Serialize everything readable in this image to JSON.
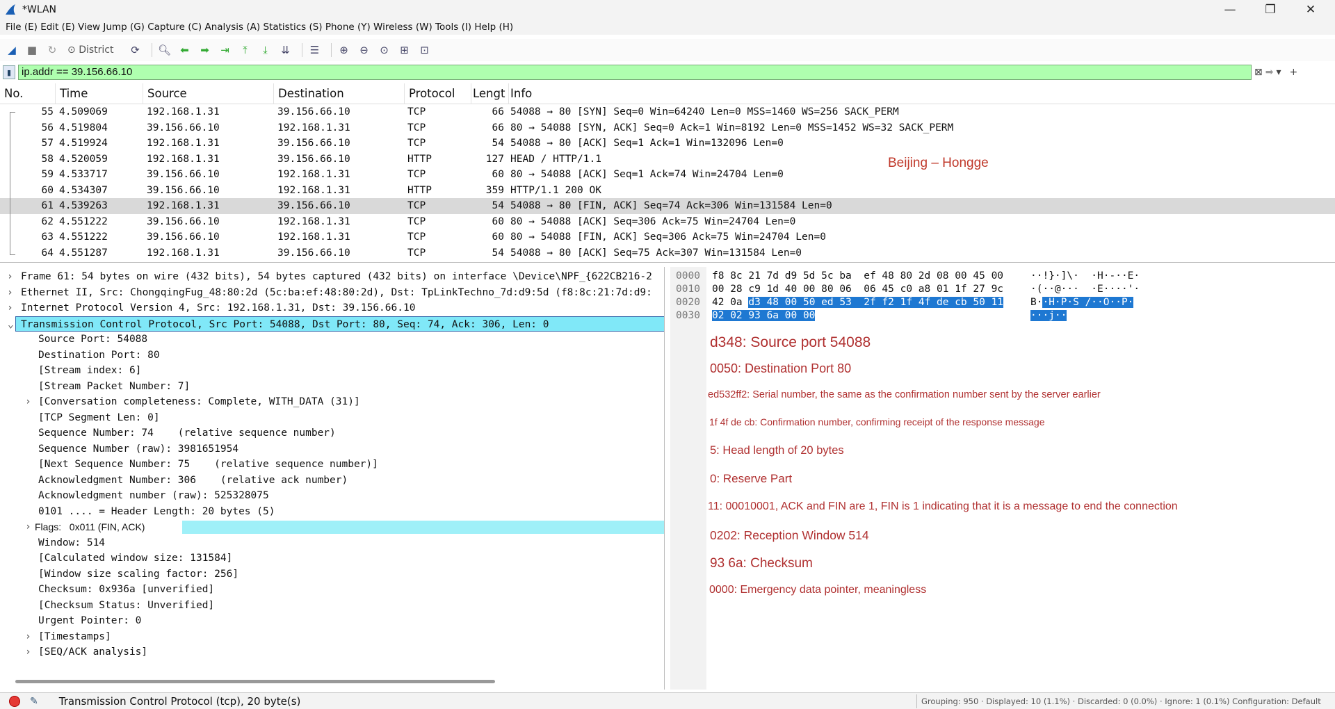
{
  "window": {
    "title": "*WLAN"
  },
  "menu": [
    "File (E)",
    "Edit (E)",
    "View",
    "Jump (G)",
    "Capture (C)",
    "Analysis (A)",
    "Statistics (S)",
    "Phone (Y)",
    "Wireless (W)",
    "Tools (I)",
    "Help (H)"
  ],
  "toolbar": {
    "district_label": "District"
  },
  "filter": {
    "value": "ip.addr == 39.156.66.10"
  },
  "packet_list": {
    "columns": [
      "No.",
      "Time",
      "Source",
      "Destination",
      "Protocol",
      "Lengt",
      "Info"
    ],
    "selected_no": "61",
    "rows": [
      {
        "no": "55",
        "time": "4.509069",
        "src": "192.168.1.31",
        "dst": "39.156.66.10",
        "proto": "TCP",
        "len": "66",
        "info": "54088 → 80 [SYN] Seq=0 Win=64240 Len=0 MSS=1460 WS=256 SACK_PERM"
      },
      {
        "no": "56",
        "time": "4.519804",
        "src": "39.156.66.10",
        "dst": "192.168.1.31",
        "proto": "TCP",
        "len": "66",
        "info": "80 → 54088 [SYN, ACK] Seq=0 Ack=1 Win=8192 Len=0 MSS=1452 WS=32 SACK_PERM"
      },
      {
        "no": "57",
        "time": "4.519924",
        "src": "192.168.1.31",
        "dst": "39.156.66.10",
        "proto": "TCP",
        "len": "54",
        "info": "54088 → 80 [ACK] Seq=1 Ack=1 Win=132096 Len=0"
      },
      {
        "no": "58",
        "time": "4.520059",
        "src": "192.168.1.31",
        "dst": "39.156.66.10",
        "proto": "HTTP",
        "len": "127",
        "info": "HEAD / HTTP/1.1"
      },
      {
        "no": "59",
        "time": "4.533717",
        "src": "39.156.66.10",
        "dst": "192.168.1.31",
        "proto": "TCP",
        "len": "60",
        "info": "80 → 54088 [ACK] Seq=1 Ack=74 Win=24704 Len=0"
      },
      {
        "no": "60",
        "time": "4.534307",
        "src": "39.156.66.10",
        "dst": "192.168.1.31",
        "proto": "HTTP",
        "len": "359",
        "info": "HTTP/1.1 200 OK"
      },
      {
        "no": "61",
        "time": "4.539263",
        "src": "192.168.1.31",
        "dst": "39.156.66.10",
        "proto": "TCP",
        "len": "54",
        "info": "54088 → 80 [FIN, ACK] Seq=74 Ack=306 Win=131584 Len=0"
      },
      {
        "no": "62",
        "time": "4.551222",
        "src": "39.156.66.10",
        "dst": "192.168.1.31",
        "proto": "TCP",
        "len": "60",
        "info": "80 → 54088 [ACK] Seq=306 Ack=75 Win=24704 Len=0"
      },
      {
        "no": "63",
        "time": "4.551222",
        "src": "39.156.66.10",
        "dst": "192.168.1.31",
        "proto": "TCP",
        "len": "60",
        "info": "80 → 54088 [FIN, ACK] Seq=306 Ack=75 Win=24704 Len=0"
      },
      {
        "no": "64",
        "time": "4.551287",
        "src": "192.168.1.31",
        "dst": "39.156.66.10",
        "proto": "TCP",
        "len": "54",
        "info": "54088 → 80 [ACK] Seq=75 Ack=307 Win=131584 Len=0"
      }
    ],
    "annotation": "Beijing – Hongge"
  },
  "details": [
    {
      "arrow": ">",
      "indent": 0,
      "text": "Frame 61: 54 bytes on wire (432 bits), 54 bytes captured (432 bits) on interface \\Device\\NPF_{622CB216-2"
    },
    {
      "arrow": ">",
      "indent": 0,
      "text": "Ethernet II, Src: ChongqingFug_48:80:2d (5c:ba:ef:48:80:2d), Dst: TpLinkTechno_7d:d9:5d (f8:8c:21:7d:d9:"
    },
    {
      "arrow": ">",
      "indent": 0,
      "text": "Internet Protocol Version 4, Src: 192.168.1.31, Dst: 39.156.66.10"
    },
    {
      "arrow": "v",
      "indent": 0,
      "text": "Transmission Control Protocol, Src Port: 54088, Dst Port: 80, Seq: 74, Ack: 306, Len: 0",
      "selected": true
    },
    {
      "arrow": "",
      "indent": 1,
      "text": "Source Port: 54088"
    },
    {
      "arrow": "",
      "indent": 1,
      "text": "Destination Port: 80"
    },
    {
      "arrow": "",
      "indent": 1,
      "text": "[Stream index: 6]"
    },
    {
      "arrow": "",
      "indent": 1,
      "text": "[Stream Packet Number: 7]"
    },
    {
      "arrow": ">",
      "indent": 1,
      "text": "[Conversation completeness: Complete, WITH_DATA (31)]"
    },
    {
      "arrow": "",
      "indent": 1,
      "text": "[TCP Segment Len: 0]"
    },
    {
      "arrow": "",
      "indent": 1,
      "text": "Sequence Number: 74    (relative sequence number)"
    },
    {
      "arrow": "",
      "indent": 1,
      "text": "Sequence Number (raw): 3981651954"
    },
    {
      "arrow": "",
      "indent": 1,
      "text": "[Next Sequence Number: 75    (relative sequence number)]"
    },
    {
      "arrow": "",
      "indent": 1,
      "text": "Acknowledgment Number: 306    (relative ack number)"
    },
    {
      "arrow": "",
      "indent": 1,
      "text": "Acknowledgment number (raw): 525328075"
    },
    {
      "arrow": "",
      "indent": 1,
      "text": "0101 .... = Header Length: 20 bytes (5)"
    },
    {
      "arrow": ">",
      "indent": 1,
      "text": "Flags:   0x011 (FIN, ACK)",
      "flags": true
    },
    {
      "arrow": "",
      "indent": 1,
      "text": "Window: 514"
    },
    {
      "arrow": "",
      "indent": 1,
      "text": "[Calculated window size: 131584]"
    },
    {
      "arrow": "",
      "indent": 1,
      "text": "[Window size scaling factor: 256]"
    },
    {
      "arrow": "",
      "indent": 1,
      "text": "Checksum: 0x936a [unverified]"
    },
    {
      "arrow": "",
      "indent": 1,
      "text": "[Checksum Status: Unverified]"
    },
    {
      "arrow": "",
      "indent": 1,
      "text": "Urgent Pointer: 0"
    },
    {
      "arrow": ">",
      "indent": 1,
      "text": "[Timestamps]"
    },
    {
      "arrow": ">",
      "indent": 1,
      "text": "[SEQ/ACK analysis]"
    }
  ],
  "hex": {
    "offsets": [
      "0000",
      "0010",
      "0020",
      "0030"
    ],
    "r0": "f8 8c 21 7d d9 5d 5c ba  ef 48 80 2d 08 00 45 00",
    "a0": "··!}·]\\·  ·H·-··E·",
    "r1": "00 28 c9 1d 40 00 80 06  06 45 c0 a8 01 1f 27 9c",
    "a1": "·(··@···  ·E····'·",
    "r2_plain": "42 0a ",
    "r2_sel": "d3 48 00 50 ed 53  2f f2 1f 4f de cb 50 11",
    "a2_plain": "B·",
    "a2_sel": "·H·P·S /··O··P·",
    "r3_sel": "02 02 93 6a 00 00",
    "a3_sel": "···j··"
  },
  "notes": [
    "d348: Source port 54088",
    "0050: Destination Port 80",
    "ed532ff2: Serial number, the same as the confirmation number sent by the server earlier",
    "1f 4f de cb: Confirmation number, confirming receipt of the response message",
    "5: Head length of 20 bytes",
    "0: Reserve Part",
    "11: 00010001, ACK and FIN are 1, FIN is 1 indicating that it is a message to end the connection",
    "0202: Reception Window 514",
    "93 6a: Checksum",
    "0000: Emergency data pointer, meaningless"
  ],
  "status": {
    "text": "Transmission Control Protocol (tcp), 20 byte(s)",
    "right": "Grouping: 950 · Displayed: 10 (1.1%) · Discarded: 0 (0.0%) · Ignore: 1 (0.1%) Configuration: Default"
  },
  "colors": {
    "filter_ok": "#afffaf",
    "selection": "#80e8f8",
    "hex_selection": "#1e78d2",
    "annotation": "#c0392b"
  }
}
